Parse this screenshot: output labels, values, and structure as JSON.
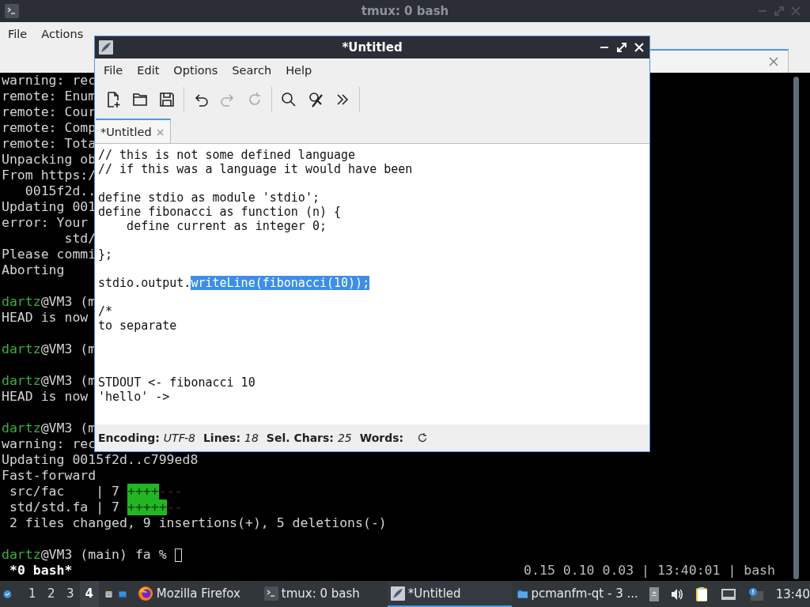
{
  "terminal_window": {
    "title": "tmux: 0 bash",
    "menu": [
      "File",
      "Actions"
    ],
    "lines": [
      {
        "kind": "text",
        "segments": [
          {
            "text": "warning: rec",
            "kind": "plain"
          }
        ]
      },
      {
        "kind": "text",
        "segments": [
          {
            "text": "remote: Enum",
            "kind": "plain"
          }
        ]
      },
      {
        "kind": "text",
        "segments": [
          {
            "text": "remote: Cour",
            "kind": "plain"
          }
        ]
      },
      {
        "kind": "text",
        "segments": [
          {
            "text": "remote: Comp",
            "kind": "plain"
          }
        ]
      },
      {
        "kind": "text",
        "segments": [
          {
            "text": "remote: Tota",
            "kind": "plain"
          }
        ]
      },
      {
        "kind": "text",
        "segments": [
          {
            "text": "Unpacking ob",
            "kind": "plain"
          }
        ]
      },
      {
        "kind": "text",
        "segments": [
          {
            "text": "From https:/",
            "kind": "plain"
          }
        ]
      },
      {
        "kind": "text",
        "segments": [
          {
            "text": "   0015f2d..",
            "kind": "plain"
          }
        ]
      },
      {
        "kind": "text",
        "segments": [
          {
            "text": "Updating 001",
            "kind": "plain"
          }
        ]
      },
      {
        "kind": "text",
        "segments": [
          {
            "text": "error: Your",
            "kind": "plain"
          }
        ]
      },
      {
        "kind": "text",
        "segments": [
          {
            "text": "        std/",
            "kind": "plain"
          }
        ]
      },
      {
        "kind": "text",
        "segments": [
          {
            "text": "Please commi",
            "kind": "plain"
          }
        ]
      },
      {
        "kind": "text",
        "segments": [
          {
            "text": "Aborting",
            "kind": "plain"
          }
        ]
      },
      {
        "kind": "blank"
      },
      {
        "kind": "text",
        "segments": [
          {
            "text": "dartz",
            "kind": "user"
          },
          {
            "text": "@VM3 (m",
            "kind": "plain"
          }
        ]
      },
      {
        "kind": "text",
        "segments": [
          {
            "text": "HEAD is now",
            "kind": "plain"
          }
        ]
      },
      {
        "kind": "blank"
      },
      {
        "kind": "text",
        "segments": [
          {
            "text": "dartz",
            "kind": "user"
          },
          {
            "text": "@VM3 (m",
            "kind": "plain"
          }
        ]
      },
      {
        "kind": "blank"
      },
      {
        "kind": "text",
        "segments": [
          {
            "text": "dartz",
            "kind": "user"
          },
          {
            "text": "@VM3 (m",
            "kind": "plain"
          }
        ]
      },
      {
        "kind": "text",
        "segments": [
          {
            "text": "HEAD is now",
            "kind": "plain"
          }
        ]
      },
      {
        "kind": "blank"
      },
      {
        "kind": "text",
        "segments": [
          {
            "text": "dartz",
            "kind": "user"
          },
          {
            "text": "@VM3 (m",
            "kind": "plain"
          }
        ]
      },
      {
        "kind": "text",
        "segments": [
          {
            "text": "warning: rec",
            "kind": "plain"
          }
        ]
      },
      {
        "kind": "text",
        "segments": [
          {
            "text": "Updating 0015f2d..c799ed8",
            "kind": "plain"
          }
        ]
      },
      {
        "kind": "text",
        "segments": [
          {
            "text": "Fast-forward",
            "kind": "plain"
          }
        ]
      },
      {
        "kind": "text",
        "segments": [
          {
            "text": " src/fac    | 7 ",
            "kind": "plain"
          },
          {
            "text": "++++",
            "kind": "added"
          },
          {
            "text": "---",
            "kind": "removed"
          }
        ]
      },
      {
        "kind": "text",
        "segments": [
          {
            "text": " std/std.fa | 7 ",
            "kind": "plain"
          },
          {
            "text": "+++++",
            "kind": "added"
          },
          {
            "text": "--",
            "kind": "removed"
          }
        ]
      },
      {
        "kind": "text",
        "segments": [
          {
            "text": " 2 files changed, 9 insertions(+), 5 deletions(-)",
            "kind": "plain"
          }
        ]
      },
      {
        "kind": "blank"
      },
      {
        "kind": "prompt",
        "segments": [
          {
            "text": "dartz",
            "kind": "user"
          },
          {
            "text": "@VM3 (main) fa % ",
            "kind": "plain"
          }
        ]
      }
    ],
    "status_left": "*0 bash*",
    "status_right": "0.15 0.10 0.03 | 13:40:01 | bash"
  },
  "editor_window": {
    "title": "*Untitled",
    "menu": [
      "File",
      "Edit",
      "Options",
      "Search",
      "Help"
    ],
    "toolbar": [
      [
        {
          "kind": "new",
          "disabled": false
        },
        {
          "kind": "open",
          "disabled": false
        },
        {
          "kind": "save",
          "disabled": false
        }
      ],
      [
        {
          "kind": "undo",
          "disabled": false
        },
        {
          "kind": "redo",
          "disabled": true
        },
        {
          "kind": "reload",
          "disabled": true
        }
      ],
      [
        {
          "kind": "find",
          "disabled": false
        },
        {
          "kind": "replace",
          "disabled": false
        },
        {
          "kind": "more",
          "disabled": false
        }
      ]
    ],
    "tab": {
      "label": "*Untitled",
      "close": "×"
    },
    "lines": [
      {
        "kind": "text",
        "segments": [
          {
            "text": "// this is not some defined language",
            "selected": false
          }
        ]
      },
      {
        "kind": "text",
        "segments": [
          {
            "text": "// if this was a language it would have been",
            "selected": false
          }
        ]
      },
      {
        "kind": "blank"
      },
      {
        "kind": "text",
        "segments": [
          {
            "text": "define stdio as module 'stdio';",
            "selected": false
          }
        ]
      },
      {
        "kind": "text",
        "segments": [
          {
            "text": "define fibonacci as function (n) {",
            "selected": false
          }
        ]
      },
      {
        "kind": "text",
        "segments": [
          {
            "text": "    define current as integer 0;",
            "selected": false
          }
        ]
      },
      {
        "kind": "blank"
      },
      {
        "kind": "text",
        "segments": [
          {
            "text": "};",
            "selected": false
          }
        ]
      },
      {
        "kind": "blank"
      },
      {
        "kind": "text",
        "segments": [
          {
            "text": "stdio.output.",
            "selected": false
          },
          {
            "text": "writeLine(fibonacci(10));",
            "selected": true
          }
        ]
      },
      {
        "kind": "blank"
      },
      {
        "kind": "text",
        "segments": [
          {
            "text": "/*",
            "selected": false
          }
        ]
      },
      {
        "kind": "text",
        "segments": [
          {
            "text": "to separate",
            "selected": false
          }
        ]
      },
      {
        "kind": "blank"
      },
      {
        "kind": "blank"
      },
      {
        "kind": "blank"
      },
      {
        "kind": "text",
        "segments": [
          {
            "text": "STDOUT <- fibonacci 10",
            "selected": false
          }
        ]
      },
      {
        "kind": "text",
        "segments": [
          {
            "text": "'hello' ->",
            "selected": false
          }
        ]
      }
    ],
    "status": [
      {
        "label": "Encoding:",
        "value": "UTF-8"
      },
      {
        "label": "Lines:",
        "value": "18"
      },
      {
        "label": "Sel. Chars:",
        "value": "25"
      },
      {
        "label": "Words:"
      }
    ]
  },
  "taskbar": {
    "workspaces": [
      {
        "label": "1",
        "selected": false
      },
      {
        "label": "2",
        "selected": false
      },
      {
        "label": "3",
        "selected": false
      },
      {
        "label": "4",
        "selected": true
      }
    ],
    "tasks": [
      {
        "kind": "firefox",
        "label": "Mozilla Firefox",
        "selected": false
      },
      {
        "kind": "terminal",
        "label": "tmux: 0 bash",
        "selected": false
      },
      {
        "kind": "editor",
        "label": "*Untitled",
        "selected": true
      },
      {
        "kind": "folder",
        "label": "pcmanfm-qt - 3 ...",
        "selected": false
      }
    ],
    "clock": "13:40"
  }
}
